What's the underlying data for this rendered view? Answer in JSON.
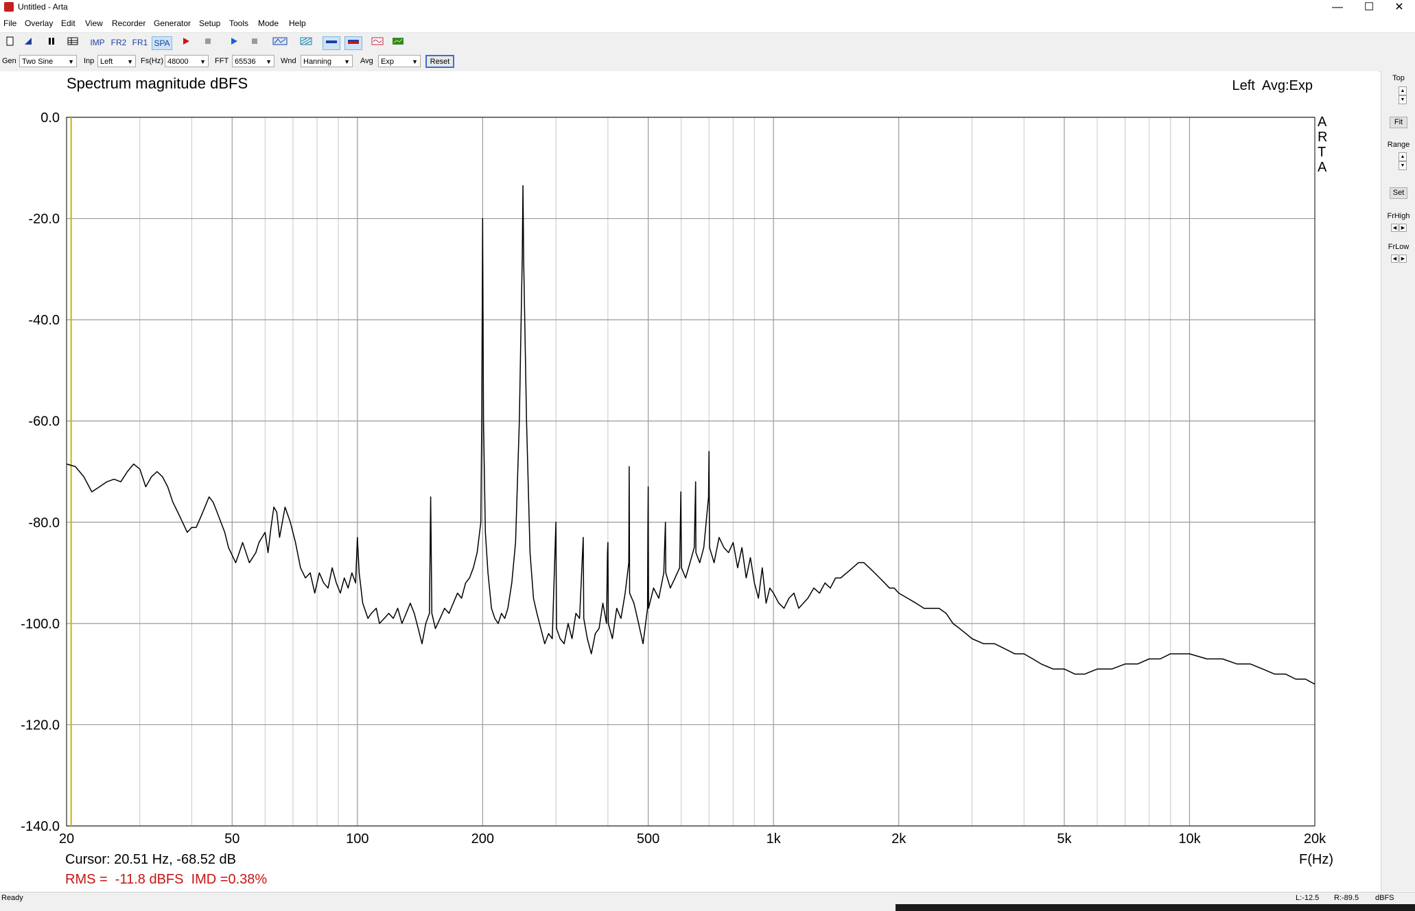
{
  "window": {
    "title": "Untitled - Arta",
    "minimize": "—",
    "maximize": "☐",
    "close": "✕"
  },
  "menu": [
    "File",
    "Overlay",
    "Edit",
    "View",
    "Recorder",
    "Generator",
    "Setup",
    "Tools",
    "Mode",
    "Help"
  ],
  "toolbar": {
    "imp": "IMP",
    "fr2": "FR2",
    "fr1": "FR1",
    "spa": "SPA"
  },
  "controls": {
    "gen_label": "Gen",
    "gen_value": "Two Sine",
    "inp_label": "Inp",
    "inp_value": "Left",
    "fs_label": "Fs(Hz)",
    "fs_value": "48000",
    "fft_label": "FFT",
    "fft_value": "65536",
    "wnd_label": "Wnd",
    "wnd_value": "Hanning",
    "avg_label": "Avg",
    "avg_value": "Exp",
    "reset": "Reset"
  },
  "plot": {
    "title": "Spectrum magnitude dBFS",
    "channel_info": "Left  Avg:Exp",
    "brand_letters": [
      "A",
      "R",
      "T",
      "A"
    ],
    "cursor": "Cursor: 20.51 Hz, -68.52 dB",
    "metrics": "RMS =  -11.8 dBFS  IMD =0.38%",
    "xunit": "F(Hz)"
  },
  "chart_data": {
    "type": "line",
    "title": "Spectrum magnitude dBFS",
    "xlabel": "F(Hz)",
    "ylabel": "",
    "xscale": "log",
    "xlim": [
      20,
      20000
    ],
    "ylim": [
      -140,
      0
    ],
    "grid": true,
    "line_color": "#000000",
    "cursor_color": "#c8b400",
    "cursor_freq": 20.51,
    "x_ticks": [
      {
        "value": 20,
        "label": "20"
      },
      {
        "value": 50,
        "label": "50"
      },
      {
        "value": 100,
        "label": "100"
      },
      {
        "value": 200,
        "label": "200"
      },
      {
        "value": 500,
        "label": "500"
      },
      {
        "value": 1000,
        "label": "1k"
      },
      {
        "value": 2000,
        "label": "2k"
      },
      {
        "value": 5000,
        "label": "5k"
      },
      {
        "value": 10000,
        "label": "10k"
      },
      {
        "value": 20000,
        "label": "20k"
      }
    ],
    "y_ticks": [
      {
        "value": 0,
        "label": "0.0"
      },
      {
        "value": -20,
        "label": "-20.0"
      },
      {
        "value": -40,
        "label": "-40.0"
      },
      {
        "value": -60,
        "label": "-60.0"
      },
      {
        "value": -80,
        "label": "-80.0"
      },
      {
        "value": -100,
        "label": "-100.0"
      },
      {
        "value": -120,
        "label": "-120.0"
      },
      {
        "value": -140,
        "label": "-140.0"
      }
    ],
    "series": [
      {
        "points": [
          [
            20,
            -68.5
          ],
          [
            21,
            -69
          ],
          [
            22,
            -71
          ],
          [
            23,
            -74
          ],
          [
            24,
            -73
          ],
          [
            25,
            -72
          ],
          [
            26,
            -71.5
          ],
          [
            27,
            -72
          ],
          [
            28,
            -70
          ],
          [
            29,
            -68.5
          ],
          [
            30,
            -69.5
          ],
          [
            31,
            -73
          ],
          [
            32,
            -71
          ],
          [
            33,
            -70
          ],
          [
            34,
            -71
          ],
          [
            35,
            -73
          ],
          [
            36,
            -76
          ],
          [
            37,
            -78
          ],
          [
            38,
            -80
          ],
          [
            39,
            -82
          ],
          [
            40,
            -81
          ],
          [
            41,
            -81
          ],
          [
            42,
            -79
          ],
          [
            43,
            -77
          ],
          [
            44,
            -75
          ],
          [
            45,
            -76
          ],
          [
            46,
            -78
          ],
          [
            48,
            -82
          ],
          [
            49,
            -85
          ],
          [
            51,
            -88
          ],
          [
            52,
            -86
          ],
          [
            53,
            -84
          ],
          [
            55,
            -88
          ],
          [
            57,
            -86
          ],
          [
            58,
            -84
          ],
          [
            60,
            -82
          ],
          [
            61,
            -86
          ],
          [
            62,
            -81
          ],
          [
            63,
            -77
          ],
          [
            64,
            -78
          ],
          [
            65,
            -83
          ],
          [
            67,
            -77
          ],
          [
            69,
            -80
          ],
          [
            71,
            -84
          ],
          [
            73,
            -89
          ],
          [
            75,
            -91
          ],
          [
            77,
            -90
          ],
          [
            79,
            -94
          ],
          [
            81,
            -90
          ],
          [
            83,
            -92
          ],
          [
            85,
            -93
          ],
          [
            87,
            -89
          ],
          [
            89,
            -92
          ],
          [
            91,
            -94
          ],
          [
            93,
            -91
          ],
          [
            95,
            -93
          ],
          [
            97,
            -90
          ],
          [
            99,
            -92
          ],
          [
            100,
            -83
          ],
          [
            101,
            -90
          ],
          [
            103,
            -96
          ],
          [
            106,
            -99
          ],
          [
            108,
            -98
          ],
          [
            111,
            -97
          ],
          [
            113,
            -100
          ],
          [
            116,
            -99
          ],
          [
            119,
            -98
          ],
          [
            122,
            -99
          ],
          [
            125,
            -97
          ],
          [
            128,
            -100
          ],
          [
            131,
            -98
          ],
          [
            134,
            -96
          ],
          [
            137,
            -98
          ],
          [
            140,
            -101
          ],
          [
            143,
            -104
          ],
          [
            146,
            -100
          ],
          [
            149,
            -98
          ],
          [
            150,
            -75
          ],
          [
            151,
            -98
          ],
          [
            154,
            -101
          ],
          [
            158,
            -99
          ],
          [
            162,
            -97
          ],
          [
            166,
            -98
          ],
          [
            170,
            -96
          ],
          [
            174,
            -94
          ],
          [
            178,
            -95
          ],
          [
            182,
            -92
          ],
          [
            186,
            -91
          ],
          [
            190,
            -89
          ],
          [
            194,
            -86
          ],
          [
            198,
            -80
          ],
          [
            199,
            -60
          ],
          [
            200,
            -20
          ],
          [
            201,
            -60
          ],
          [
            203,
            -82
          ],
          [
            206,
            -90
          ],
          [
            210,
            -97
          ],
          [
            214,
            -99
          ],
          [
            218,
            -100
          ],
          [
            222,
            -98
          ],
          [
            226,
            -99
          ],
          [
            230,
            -97
          ],
          [
            235,
            -92
          ],
          [
            240,
            -84
          ],
          [
            245,
            -60
          ],
          [
            249,
            -28
          ],
          [
            250,
            -13.5
          ],
          [
            251,
            -28
          ],
          [
            255,
            -60
          ],
          [
            260,
            -86
          ],
          [
            265,
            -95
          ],
          [
            270,
            -98
          ],
          [
            276,
            -101
          ],
          [
            282,
            -104
          ],
          [
            288,
            -102
          ],
          [
            294,
            -103
          ],
          [
            300,
            -80
          ],
          [
            301,
            -101
          ],
          [
            307,
            -103
          ],
          [
            314,
            -104
          ],
          [
            321,
            -100
          ],
          [
            328,
            -103
          ],
          [
            335,
            -98
          ],
          [
            342,
            -99
          ],
          [
            349,
            -83
          ],
          [
            350,
            -99
          ],
          [
            357,
            -103
          ],
          [
            365,
            -106
          ],
          [
            373,
            -102
          ],
          [
            381,
            -101
          ],
          [
            389,
            -96
          ],
          [
            397,
            -100
          ],
          [
            399,
            -86
          ],
          [
            400,
            -84
          ],
          [
            401,
            -100
          ],
          [
            410,
            -103
          ],
          [
            420,
            -97
          ],
          [
            430,
            -99
          ],
          [
            440,
            -94
          ],
          [
            449,
            -88
          ],
          [
            450,
            -69
          ],
          [
            451,
            -94
          ],
          [
            462,
            -96
          ],
          [
            474,
            -100
          ],
          [
            486,
            -104
          ],
          [
            498,
            -97
          ],
          [
            499,
            -82
          ],
          [
            500,
            -73
          ],
          [
            501,
            -97
          ],
          [
            515,
            -93
          ],
          [
            530,
            -95
          ],
          [
            545,
            -90
          ],
          [
            549,
            -82
          ],
          [
            550,
            -80
          ],
          [
            551,
            -90
          ],
          [
            565,
            -93
          ],
          [
            580,
            -91
          ],
          [
            595,
            -89
          ],
          [
            599,
            -74
          ],
          [
            600,
            -81
          ],
          [
            601,
            -89
          ],
          [
            615,
            -91
          ],
          [
            630,
            -88
          ],
          [
            645,
            -85
          ],
          [
            650,
            -72
          ],
          [
            651,
            -86
          ],
          [
            665,
            -88
          ],
          [
            680,
            -85
          ],
          [
            698,
            -75
          ],
          [
            700,
            -66
          ],
          [
            702,
            -85
          ],
          [
            720,
            -88
          ],
          [
            740,
            -83
          ],
          [
            760,
            -85
          ],
          [
            780,
            -86
          ],
          [
            800,
            -84
          ],
          [
            820,
            -89
          ],
          [
            840,
            -85
          ],
          [
            860,
            -91
          ],
          [
            880,
            -87
          ],
          [
            900,
            -92
          ],
          [
            920,
            -95
          ],
          [
            940,
            -89
          ],
          [
            960,
            -96
          ],
          [
            980,
            -93
          ],
          [
            1000,
            -94
          ],
          [
            1030,
            -96
          ],
          [
            1060,
            -97
          ],
          [
            1090,
            -95
          ],
          [
            1120,
            -94
          ],
          [
            1150,
            -97
          ],
          [
            1180,
            -96
          ],
          [
            1210,
            -95
          ],
          [
            1250,
            -93
          ],
          [
            1290,
            -94
          ],
          [
            1330,
            -92
          ],
          [
            1370,
            -93
          ],
          [
            1410,
            -91
          ],
          [
            1450,
            -91
          ],
          [
            1500,
            -90
          ],
          [
            1550,
            -89
          ],
          [
            1600,
            -88
          ],
          [
            1650,
            -88
          ],
          [
            1700,
            -89
          ],
          [
            1750,
            -90
          ],
          [
            1800,
            -91
          ],
          [
            1850,
            -92
          ],
          [
            1900,
            -93
          ],
          [
            1950,
            -93
          ],
          [
            2000,
            -94
          ],
          [
            2100,
            -95
          ],
          [
            2200,
            -96
          ],
          [
            2300,
            -97
          ],
          [
            2400,
            -97
          ],
          [
            2500,
            -97
          ],
          [
            2600,
            -98
          ],
          [
            2700,
            -100
          ],
          [
            2800,
            -101
          ],
          [
            2900,
            -102
          ],
          [
            3000,
            -103
          ],
          [
            3200,
            -104
          ],
          [
            3400,
            -104
          ],
          [
            3600,
            -105
          ],
          [
            3800,
            -106
          ],
          [
            4000,
            -106
          ],
          [
            4200,
            -107
          ],
          [
            4400,
            -108
          ],
          [
            4700,
            -109
          ],
          [
            5000,
            -109
          ],
          [
            5300,
            -110
          ],
          [
            5600,
            -110
          ],
          [
            6000,
            -109
          ],
          [
            6500,
            -109
          ],
          [
            7000,
            -108
          ],
          [
            7500,
            -108
          ],
          [
            8000,
            -107
          ],
          [
            8500,
            -107
          ],
          [
            9000,
            -106
          ],
          [
            9500,
            -106
          ],
          [
            10000,
            -106
          ],
          [
            11000,
            -107
          ],
          [
            12000,
            -107
          ],
          [
            13000,
            -108
          ],
          [
            14000,
            -108
          ],
          [
            15000,
            -109
          ],
          [
            16000,
            -110
          ],
          [
            17000,
            -110
          ],
          [
            18000,
            -111
          ],
          [
            19000,
            -111
          ],
          [
            20000,
            -112
          ]
        ]
      }
    ]
  },
  "right_panel": {
    "top": "Top",
    "fit": "Fit",
    "range": "Range",
    "set": "Set",
    "frhigh": "FrHigh",
    "frlow": "FrLow"
  },
  "status": {
    "ready": "Ready",
    "l": "L:-12.5",
    "r": "R:-89.5",
    "unit": "dBFS"
  }
}
